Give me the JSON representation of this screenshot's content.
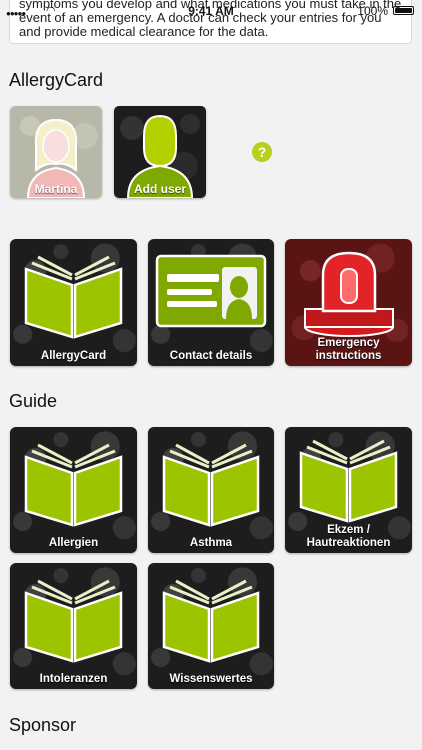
{
  "statusbar": {
    "time": "9:41 AM",
    "battery": "100%"
  },
  "info_box": {
    "text": "symptoms you develop and what medications you must take in the event of an emergency. A doctor can check your entries for you and provide medical clearance for the data."
  },
  "sections": {
    "allergycard": "AllergyCard",
    "guide": "Guide",
    "sponsor": "Sponsor"
  },
  "users": [
    {
      "label": "Martina"
    },
    {
      "label": "Add user"
    }
  ],
  "help": {
    "label": "?"
  },
  "card_tiles": [
    {
      "label": "AllergyCard",
      "icon": "book-icon"
    },
    {
      "label": "Contact details",
      "icon": "id-card-icon"
    },
    {
      "label": "Emergency instructions",
      "icon": "alarm-light-icon"
    }
  ],
  "guide_tiles": [
    {
      "label": "Allergien",
      "icon": "book-icon"
    },
    {
      "label": "Asthma",
      "icon": "book-icon"
    },
    {
      "label": "Ekzem / Hautreaktionen",
      "icon": "book-icon"
    },
    {
      "label": "Intoleranzen",
      "icon": "book-icon"
    },
    {
      "label": "Wissenswertes",
      "icon": "book-icon"
    }
  ],
  "colors": {
    "accent": "#b9cf1d",
    "tile_bg": "#1d1d1d",
    "emergency": "#c0181b"
  }
}
